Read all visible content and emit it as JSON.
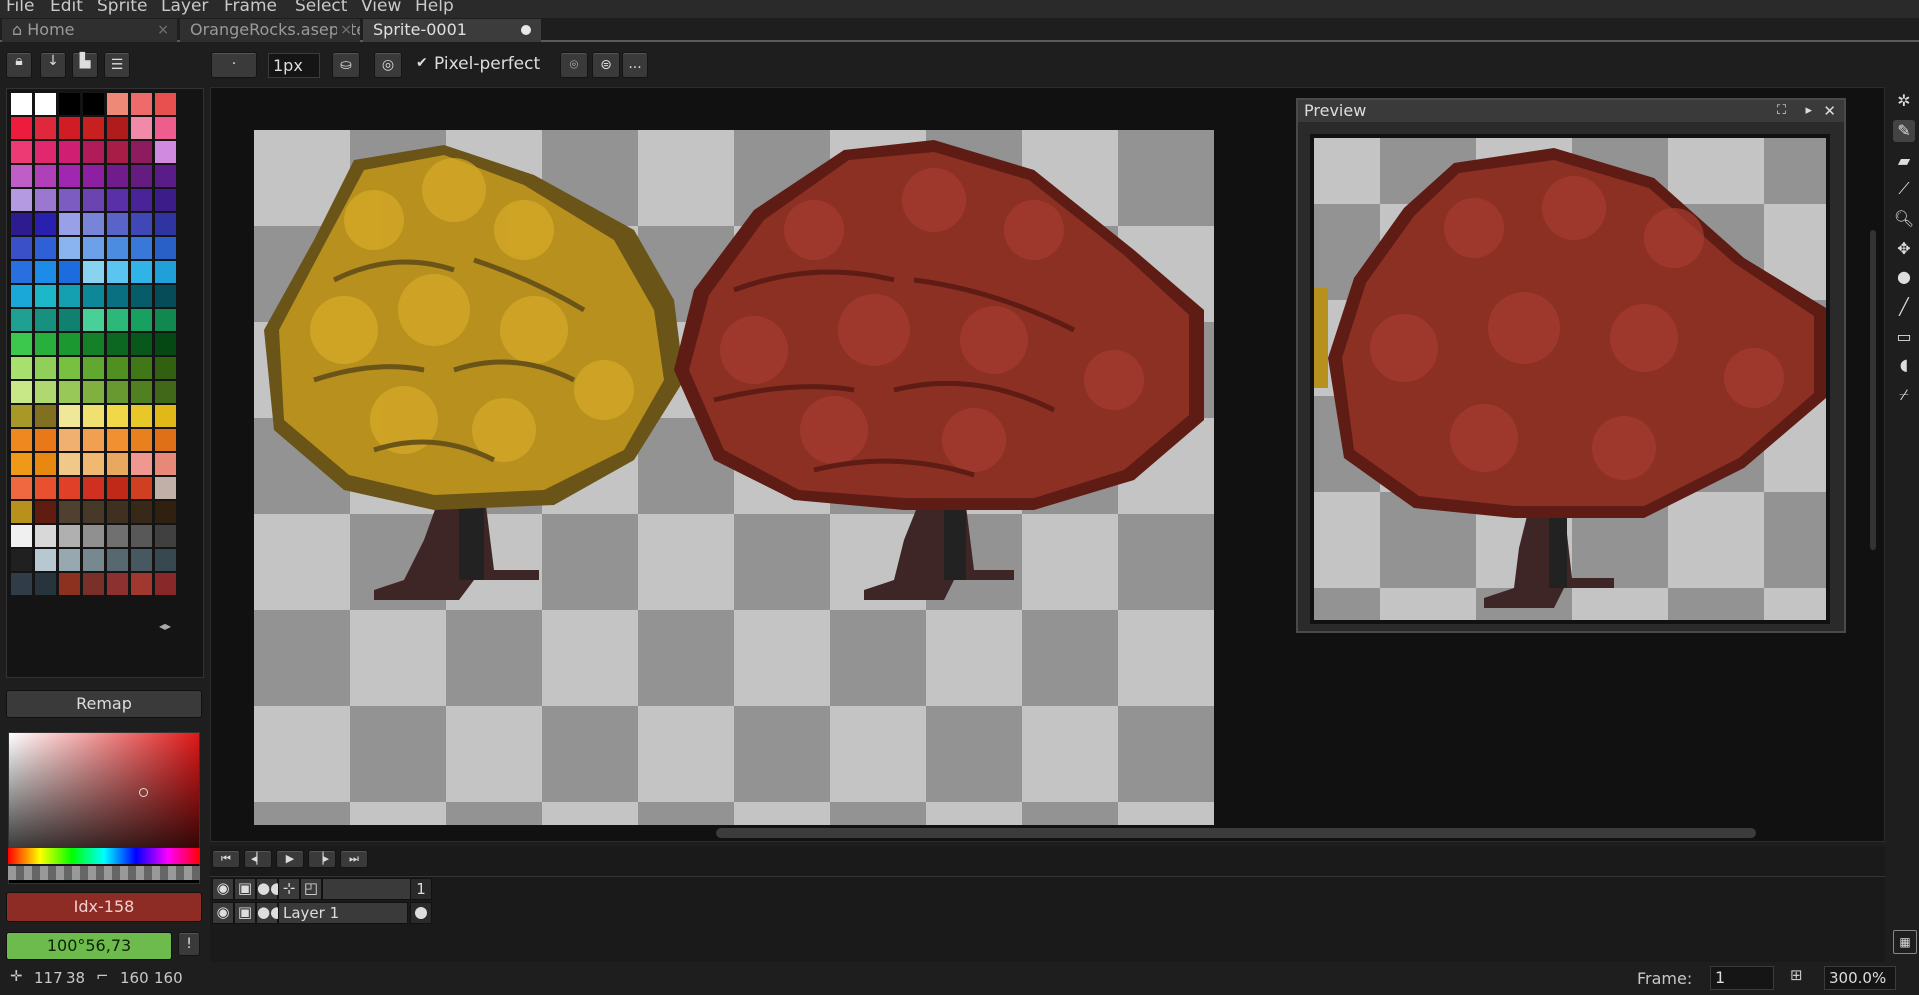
{
  "menu": [
    "File",
    "Edit",
    "Sprite",
    "Layer",
    "Frame",
    "Select",
    "View",
    "Help"
  ],
  "tabs": [
    {
      "label": "Home"
    },
    {
      "label": "OrangeRocks.aseprite"
    },
    {
      "label": "Sprite-0001"
    }
  ],
  "toolbar": {
    "brush_size": "1px",
    "pixel_perfect_label": "Pixel-perfect",
    "pixel_perfect_checked": true,
    "more": "..."
  },
  "palette_panel": {
    "remap_label": "Remap",
    "color_index": "Idx-158",
    "hsv_value": "100°56,73",
    "swatches": [
      "#ffffff",
      "#ffffff",
      "#000000",
      "#000000",
      "#ee8877",
      "#ee6b6b",
      "#e84f4f",
      "#ee1c3c",
      "#e0283c",
      "#d01c24",
      "#c82020",
      "#b01c1c",
      "#f08aa8",
      "#ee5d8d",
      "#ee3a74",
      "#e0286e",
      "#d01e72",
      "#b01c58",
      "#a81c48",
      "#8c1c5e",
      "#d08ae0",
      "#c05ec8",
      "#b040b8",
      "#a028b0",
      "#8c20a0",
      "#701c8c",
      "#641c80",
      "#5a1c88",
      "#b49ae0",
      "#9a78d0",
      "#7c5cc0",
      "#6a44b0",
      "#5a30a8",
      "#482498",
      "#3c1c88",
      "#2c1c90",
      "#2a20b0",
      "#9aa0e8",
      "#7884d8",
      "#5a64c8",
      "#4048b8",
      "#3034a0",
      "#3a50c8",
      "#3060d8",
      "#8ab4f0",
      "#6ca0e8",
      "#4c8ce0",
      "#3878d8",
      "#2860c8",
      "#2870e0",
      "#1c8ce8",
      "#1c6ce0",
      "#88d4f0",
      "#5cc4f0",
      "#30b4e8",
      "#20a0d8",
      "#1aa8d8",
      "#1cb8c8",
      "#14a0b0",
      "#0c8898",
      "#087080",
      "#065c68",
      "#054c58",
      "#20a090",
      "#189080",
      "#108070",
      "#48d098",
      "#2cb878",
      "#18a060",
      "#108850",
      "#3cc84c",
      "#28b03c",
      "#1c9830",
      "#148028",
      "#0c6820",
      "#08581c",
      "#064814",
      "#a8e070",
      "#90d058",
      "#78c040",
      "#60a830",
      "#509020",
      "#407818",
      "#306010",
      "#c8e888",
      "#b0d870",
      "#98c858",
      "#80b040",
      "#689830",
      "#508020",
      "#406818",
      "#a89828",
      "#807020",
      "#f0e898",
      "#f0e070",
      "#f0d848",
      "#e8c828",
      "#e0b818",
      "#f08820",
      "#e87818",
      "#f0b070",
      "#f0a050",
      "#f09030",
      "#e88020",
      "#e07018",
      "#f09818",
      "#e88810",
      "#f0c888",
      "#f0b870",
      "#e8a860",
      "#f09890",
      "#e88878",
      "#f06840",
      "#e85030",
      "#e04028",
      "#d03020",
      "#c02818",
      "#d04020",
      "#c0b0a8",
      "#b8901c",
      "#601c10",
      "#504030",
      "#483828",
      "#403020",
      "#382818",
      "#302010",
      "#f0f0f0",
      "#d8d8d8",
      "#b0b0b0",
      "#909090",
      "#707070",
      "#585858",
      "#404040",
      "#202020",
      "#b8c8d0",
      "#98a8b0",
      "#788890",
      "#586870",
      "#485860",
      "#384850",
      "#303c48",
      "#28343c",
      "#8c3020",
      "#783028",
      "#8c3030",
      "#a03830",
      "#882828"
    ]
  },
  "preview": {
    "title": "Preview"
  },
  "timeline": {
    "frame_number": "1",
    "layer_name": "Layer 1"
  },
  "status": {
    "cursor_x": "117",
    "cursor_y": "38",
    "size_w": "160",
    "size_h": "160",
    "frame_label": "Frame:",
    "frame_value": "1",
    "zoom": "300.0%"
  }
}
